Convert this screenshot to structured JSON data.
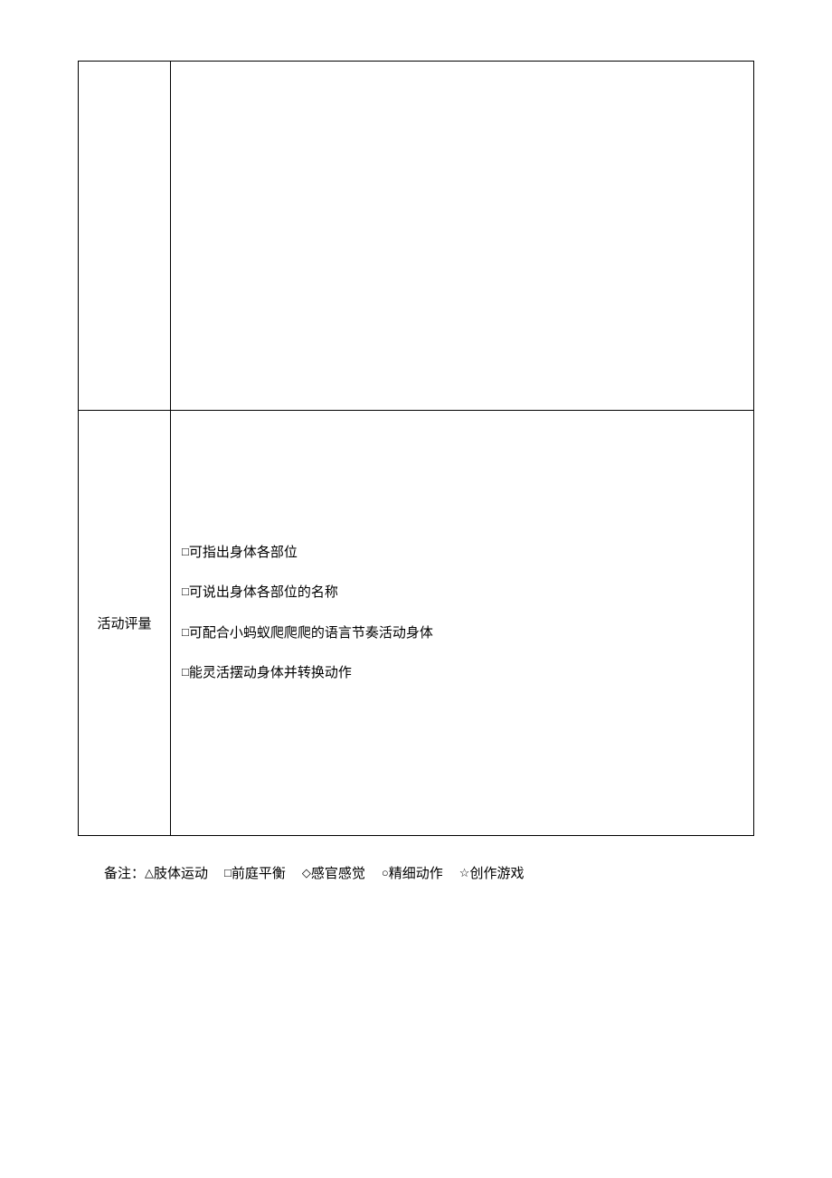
{
  "table": {
    "row1": {
      "label": "",
      "content": ""
    },
    "row2": {
      "label": "活动评量",
      "items": [
        "可指出身体各部位",
        "可说出身体各部位的名称",
        "可配合小蚂蚁爬爬爬的语言节奏活动身体",
        "能灵活摆动身体并转换动作"
      ]
    }
  },
  "footnote": {
    "prefix": "备注：",
    "legend": [
      {
        "mark": "△",
        "label": "肢体运动"
      },
      {
        "mark": "□",
        "label": "前庭平衡"
      },
      {
        "mark": "◇",
        "label": "感官感觉"
      },
      {
        "mark": "○",
        "label": "精细动作"
      },
      {
        "mark": "☆",
        "label": "创作游戏"
      }
    ]
  },
  "checkbox_mark": "□"
}
